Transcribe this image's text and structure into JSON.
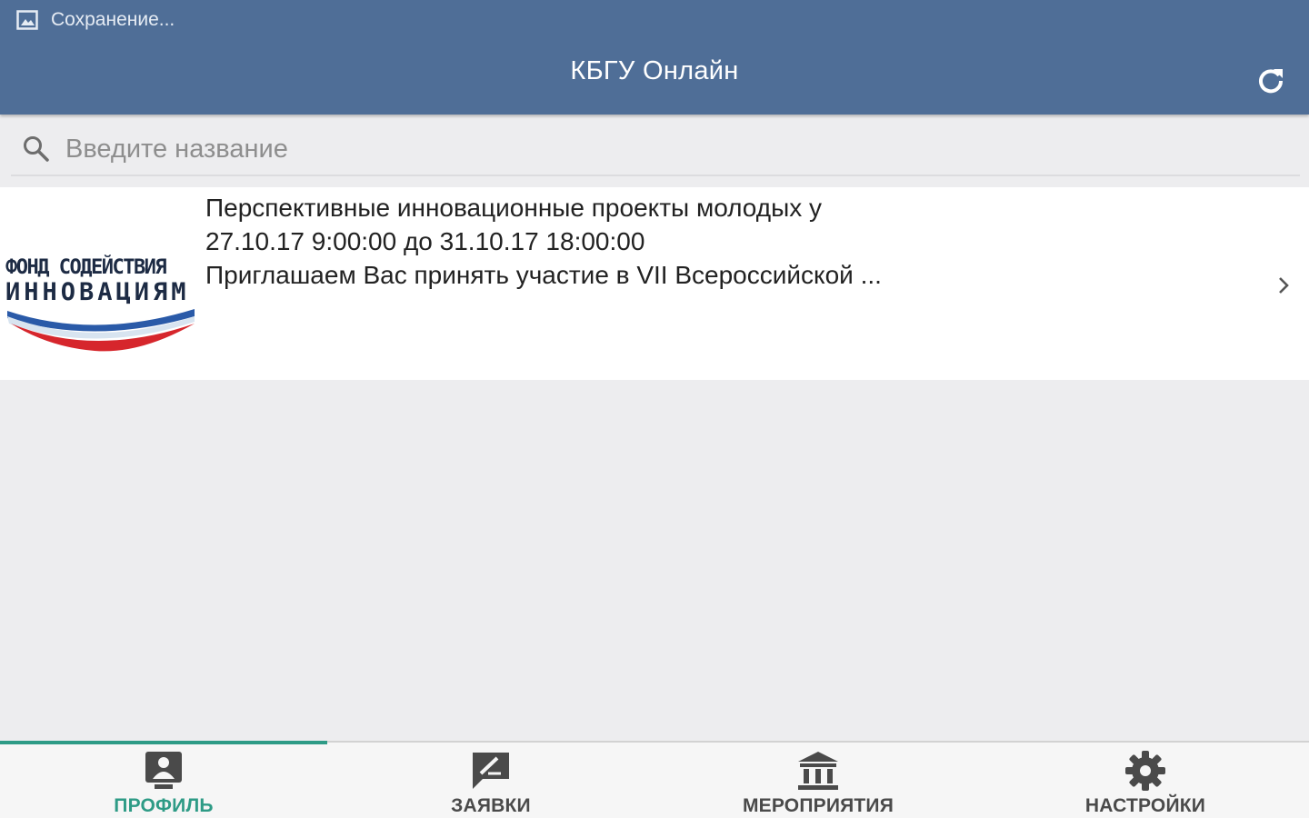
{
  "status_bar": {
    "text": "Сохранение..."
  },
  "header": {
    "title": "КБГУ Онлайн",
    "refresh_icon": "refresh-icon"
  },
  "search": {
    "placeholder": "Введите название",
    "value": ""
  },
  "events": [
    {
      "title": "Перспективные инновационные проекты молодых у",
      "dates": "27.10.17 9:00:00 до 31.10.17 18:00:00",
      "description": "Приглашаем Вас принять участие в VII Всероссийской ...",
      "logo": {
        "line1": "ФОНД СОДЕЙСТВИЯ",
        "line2": "ИННОВАЦИЯМ"
      }
    }
  ],
  "bottom_nav": {
    "tabs": [
      {
        "label": "ПРОФИЛЬ",
        "icon": "profile-icon",
        "active": true
      },
      {
        "label": "ЗАЯВКИ",
        "icon": "edit-icon",
        "active": false
      },
      {
        "label": "МЕРОПРИЯТИЯ",
        "icon": "institution-icon",
        "active": false
      },
      {
        "label": "НАСТРОЙКИ",
        "icon": "gear-icon",
        "active": false
      }
    ]
  },
  "colors": {
    "header_bg": "#4f6e97",
    "accent": "#2e9b86",
    "page_bg": "#ededef"
  }
}
